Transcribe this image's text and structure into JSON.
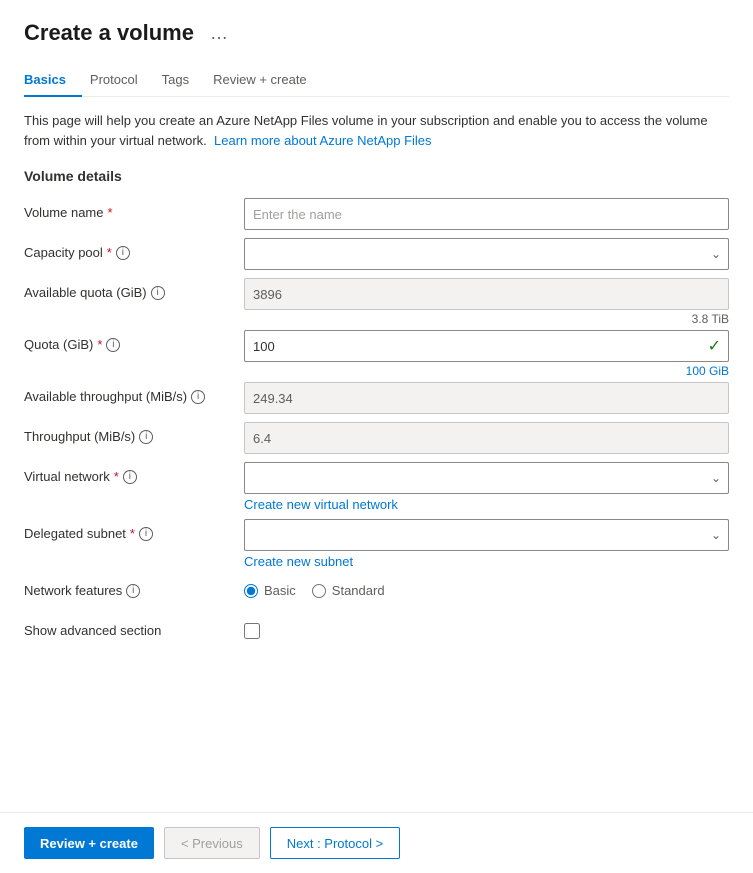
{
  "page": {
    "title": "Create a volume",
    "ellipsis_label": "…"
  },
  "tabs": [
    {
      "id": "basics",
      "label": "Basics",
      "active": true
    },
    {
      "id": "protocol",
      "label": "Protocol",
      "active": false
    },
    {
      "id": "tags",
      "label": "Tags",
      "active": false
    },
    {
      "id": "review_create",
      "label": "Review + create",
      "active": false
    }
  ],
  "info_text": {
    "main": "This page will help you create an Azure NetApp Files volume in your subscription and enable you to access the volume from within your virtual network.",
    "link_text": "Learn more about Azure NetApp Files",
    "link_href": "#"
  },
  "volume_details": {
    "section_title": "Volume details",
    "fields": {
      "volume_name": {
        "label": "Volume name",
        "required": true,
        "placeholder": "Enter the name",
        "value": ""
      },
      "capacity_pool": {
        "label": "Capacity pool",
        "required": true,
        "has_info": true,
        "value": ""
      },
      "available_quota": {
        "label": "Available quota (GiB)",
        "has_info": true,
        "value": "3896",
        "hint": "3.8 TiB"
      },
      "quota": {
        "label": "Quota (GiB)",
        "required": true,
        "has_info": true,
        "value": "100",
        "hint": "100 GiB"
      },
      "available_throughput": {
        "label": "Available throughput (MiB/s)",
        "has_info": true,
        "value": "249.34"
      },
      "throughput": {
        "label": "Throughput (MiB/s)",
        "has_info": true,
        "value": "6.4"
      },
      "virtual_network": {
        "label": "Virtual network",
        "required": true,
        "has_info": true,
        "value": "",
        "create_link": "Create new virtual network"
      },
      "delegated_subnet": {
        "label": "Delegated subnet",
        "required": true,
        "has_info": true,
        "value": "",
        "create_link": "Create new subnet"
      },
      "network_features": {
        "label": "Network features",
        "has_info": true,
        "options": [
          "Basic",
          "Standard"
        ],
        "selected": "Basic"
      },
      "show_advanced": {
        "label": "Show advanced section",
        "checked": false
      }
    }
  },
  "footer": {
    "review_create_label": "Review + create",
    "previous_label": "< Previous",
    "next_label": "Next : Protocol >"
  }
}
